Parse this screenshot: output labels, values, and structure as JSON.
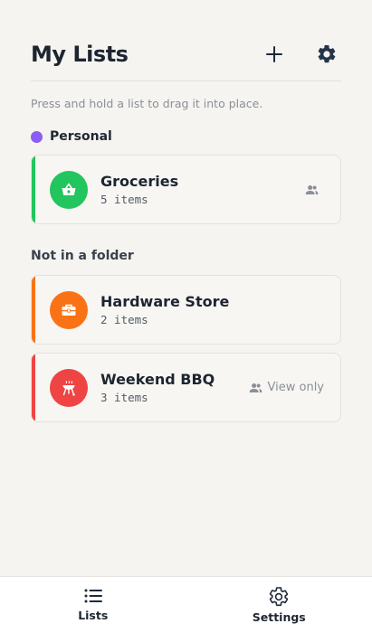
{
  "header": {
    "title": "My Lists",
    "add_icon": "plus-icon",
    "settings_icon": "gear-icon"
  },
  "hint": "Press and hold a list to drag it into place.",
  "folders": [
    {
      "name": "Personal",
      "color": "#8b5cf6",
      "lists": [
        {
          "name": "Groceries",
          "count": "5 items",
          "color": "#22c55e",
          "icon": "basket-icon",
          "shared_icon": "people-icon",
          "status": ""
        }
      ]
    }
  ],
  "unfiled": {
    "label": "Not in a folder",
    "lists": [
      {
        "name": "Hardware Store",
        "count": "2 items",
        "color": "#f97316",
        "icon": "toolbox-icon",
        "shared_icon": "",
        "status": ""
      },
      {
        "name": "Weekend BBQ",
        "count": "3 items",
        "color": "#ef4444",
        "icon": "grill-icon",
        "shared_icon": "people-icon",
        "status": "View only"
      }
    ]
  },
  "tabbar": {
    "tabs": [
      {
        "label": "Lists",
        "icon": "list-icon",
        "active": true
      },
      {
        "label": "Settings",
        "icon": "gear-icon",
        "active": false
      }
    ]
  }
}
